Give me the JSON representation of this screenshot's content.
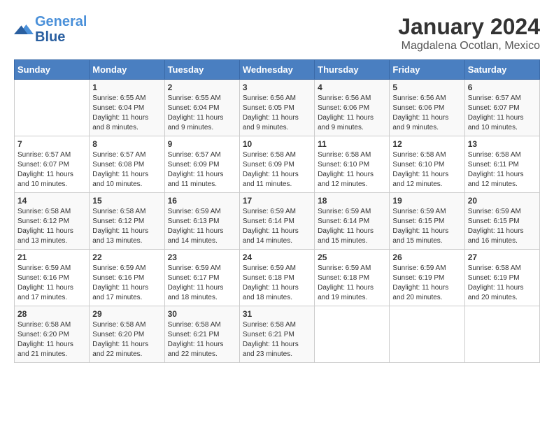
{
  "logo": {
    "line1": "General",
    "line2": "Blue"
  },
  "title": "January 2024",
  "subtitle": "Magdalena Ocotlan, Mexico",
  "weekdays": [
    "Sunday",
    "Monday",
    "Tuesday",
    "Wednesday",
    "Thursday",
    "Friday",
    "Saturday"
  ],
  "weeks": [
    [
      {
        "day": "",
        "sunrise": "",
        "sunset": "",
        "daylight": ""
      },
      {
        "day": "1",
        "sunrise": "Sunrise: 6:55 AM",
        "sunset": "Sunset: 6:04 PM",
        "daylight": "Daylight: 11 hours and 8 minutes."
      },
      {
        "day": "2",
        "sunrise": "Sunrise: 6:55 AM",
        "sunset": "Sunset: 6:04 PM",
        "daylight": "Daylight: 11 hours and 9 minutes."
      },
      {
        "day": "3",
        "sunrise": "Sunrise: 6:56 AM",
        "sunset": "Sunset: 6:05 PM",
        "daylight": "Daylight: 11 hours and 9 minutes."
      },
      {
        "day": "4",
        "sunrise": "Sunrise: 6:56 AM",
        "sunset": "Sunset: 6:06 PM",
        "daylight": "Daylight: 11 hours and 9 minutes."
      },
      {
        "day": "5",
        "sunrise": "Sunrise: 6:56 AM",
        "sunset": "Sunset: 6:06 PM",
        "daylight": "Daylight: 11 hours and 9 minutes."
      },
      {
        "day": "6",
        "sunrise": "Sunrise: 6:57 AM",
        "sunset": "Sunset: 6:07 PM",
        "daylight": "Daylight: 11 hours and 10 minutes."
      }
    ],
    [
      {
        "day": "7",
        "sunrise": "Sunrise: 6:57 AM",
        "sunset": "Sunset: 6:07 PM",
        "daylight": "Daylight: 11 hours and 10 minutes."
      },
      {
        "day": "8",
        "sunrise": "Sunrise: 6:57 AM",
        "sunset": "Sunset: 6:08 PM",
        "daylight": "Daylight: 11 hours and 10 minutes."
      },
      {
        "day": "9",
        "sunrise": "Sunrise: 6:57 AM",
        "sunset": "Sunset: 6:09 PM",
        "daylight": "Daylight: 11 hours and 11 minutes."
      },
      {
        "day": "10",
        "sunrise": "Sunrise: 6:58 AM",
        "sunset": "Sunset: 6:09 PM",
        "daylight": "Daylight: 11 hours and 11 minutes."
      },
      {
        "day": "11",
        "sunrise": "Sunrise: 6:58 AM",
        "sunset": "Sunset: 6:10 PM",
        "daylight": "Daylight: 11 hours and 12 minutes."
      },
      {
        "day": "12",
        "sunrise": "Sunrise: 6:58 AM",
        "sunset": "Sunset: 6:10 PM",
        "daylight": "Daylight: 11 hours and 12 minutes."
      },
      {
        "day": "13",
        "sunrise": "Sunrise: 6:58 AM",
        "sunset": "Sunset: 6:11 PM",
        "daylight": "Daylight: 11 hours and 12 minutes."
      }
    ],
    [
      {
        "day": "14",
        "sunrise": "Sunrise: 6:58 AM",
        "sunset": "Sunset: 6:12 PM",
        "daylight": "Daylight: 11 hours and 13 minutes."
      },
      {
        "day": "15",
        "sunrise": "Sunrise: 6:58 AM",
        "sunset": "Sunset: 6:12 PM",
        "daylight": "Daylight: 11 hours and 13 minutes."
      },
      {
        "day": "16",
        "sunrise": "Sunrise: 6:59 AM",
        "sunset": "Sunset: 6:13 PM",
        "daylight": "Daylight: 11 hours and 14 minutes."
      },
      {
        "day": "17",
        "sunrise": "Sunrise: 6:59 AM",
        "sunset": "Sunset: 6:14 PM",
        "daylight": "Daylight: 11 hours and 14 minutes."
      },
      {
        "day": "18",
        "sunrise": "Sunrise: 6:59 AM",
        "sunset": "Sunset: 6:14 PM",
        "daylight": "Daylight: 11 hours and 15 minutes."
      },
      {
        "day": "19",
        "sunrise": "Sunrise: 6:59 AM",
        "sunset": "Sunset: 6:15 PM",
        "daylight": "Daylight: 11 hours and 15 minutes."
      },
      {
        "day": "20",
        "sunrise": "Sunrise: 6:59 AM",
        "sunset": "Sunset: 6:15 PM",
        "daylight": "Daylight: 11 hours and 16 minutes."
      }
    ],
    [
      {
        "day": "21",
        "sunrise": "Sunrise: 6:59 AM",
        "sunset": "Sunset: 6:16 PM",
        "daylight": "Daylight: 11 hours and 17 minutes."
      },
      {
        "day": "22",
        "sunrise": "Sunrise: 6:59 AM",
        "sunset": "Sunset: 6:16 PM",
        "daylight": "Daylight: 11 hours and 17 minutes."
      },
      {
        "day": "23",
        "sunrise": "Sunrise: 6:59 AM",
        "sunset": "Sunset: 6:17 PM",
        "daylight": "Daylight: 11 hours and 18 minutes."
      },
      {
        "day": "24",
        "sunrise": "Sunrise: 6:59 AM",
        "sunset": "Sunset: 6:18 PM",
        "daylight": "Daylight: 11 hours and 18 minutes."
      },
      {
        "day": "25",
        "sunrise": "Sunrise: 6:59 AM",
        "sunset": "Sunset: 6:18 PM",
        "daylight": "Daylight: 11 hours and 19 minutes."
      },
      {
        "day": "26",
        "sunrise": "Sunrise: 6:59 AM",
        "sunset": "Sunset: 6:19 PM",
        "daylight": "Daylight: 11 hours and 20 minutes."
      },
      {
        "day": "27",
        "sunrise": "Sunrise: 6:58 AM",
        "sunset": "Sunset: 6:19 PM",
        "daylight": "Daylight: 11 hours and 20 minutes."
      }
    ],
    [
      {
        "day": "28",
        "sunrise": "Sunrise: 6:58 AM",
        "sunset": "Sunset: 6:20 PM",
        "daylight": "Daylight: 11 hours and 21 minutes."
      },
      {
        "day": "29",
        "sunrise": "Sunrise: 6:58 AM",
        "sunset": "Sunset: 6:20 PM",
        "daylight": "Daylight: 11 hours and 22 minutes."
      },
      {
        "day": "30",
        "sunrise": "Sunrise: 6:58 AM",
        "sunset": "Sunset: 6:21 PM",
        "daylight": "Daylight: 11 hours and 22 minutes."
      },
      {
        "day": "31",
        "sunrise": "Sunrise: 6:58 AM",
        "sunset": "Sunset: 6:21 PM",
        "daylight": "Daylight: 11 hours and 23 minutes."
      },
      {
        "day": "",
        "sunrise": "",
        "sunset": "",
        "daylight": ""
      },
      {
        "day": "",
        "sunrise": "",
        "sunset": "",
        "daylight": ""
      },
      {
        "day": "",
        "sunrise": "",
        "sunset": "",
        "daylight": ""
      }
    ]
  ]
}
